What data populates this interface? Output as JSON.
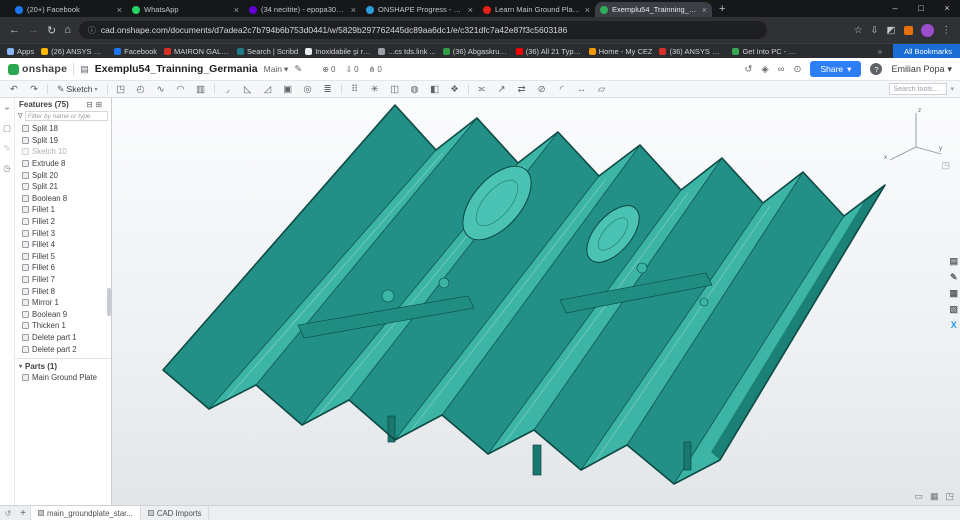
{
  "browser": {
    "tabs": [
      {
        "label": "(20+) Facebook",
        "favicon_color": "#1877f2"
      },
      {
        "label": "WhatsApp",
        "favicon_color": "#25d366"
      },
      {
        "label": "(34 necitite) - epopa3000@yah...",
        "favicon_color": "#6001d2"
      },
      {
        "label": "ONSHAPE Progress - Mind Lus...",
        "favicon_color": "#2d9cdb"
      },
      {
        "label": "Learn Main Ground Plate Onsh...",
        "favicon_color": "#e62117"
      },
      {
        "label": "Exemplu54_Trainning_Germani...",
        "favicon_color": "#2fae57"
      }
    ],
    "tab_close_glyph": "×",
    "new_tab_glyph": "+",
    "window_controls": {
      "minimize": "–",
      "maximize": "□",
      "close": "×"
    },
    "nav": {
      "back": "←",
      "forward": "→",
      "reload": "↻",
      "home": "⌂"
    },
    "address": {
      "info_icon": "ⓘ",
      "url": "cad.onshape.com/documents/d7adea2c7b794b6b753d0441/w/5829b297762445dc89aa6dc1/e/c321dfc7a42e87f3c5603186"
    },
    "address_icons": {
      "star": "☆",
      "downloads": "⇩",
      "extensions": "◩",
      "menu": "⋮"
    },
    "extension_dot_color": "#e8710a",
    "avatar_color": "#9c4dcc",
    "bookmarks": [
      {
        "label": "Apps",
        "favicon_color": "#8ab4f8"
      },
      {
        "label": "(26) ANSYS Workbe...",
        "favicon_color": "#ffb900"
      },
      {
        "label": "Facebook",
        "favicon_color": "#1877f2"
      },
      {
        "label": "MAIRON GALATI SA",
        "favicon_color": "#d93025"
      },
      {
        "label": "Search | Scribd",
        "favicon_color": "#1e7b85"
      },
      {
        "label": "Inoxidabile şi rezist...",
        "favicon_color": "#e8eaed"
      },
      {
        "label": "...cs tds.link ...",
        "favicon_color": "#9aa0a6"
      },
      {
        "label": "(36) Abgaskruemme...",
        "favicon_color": "#2e9e46"
      },
      {
        "label": "(36) All 21 Types of...",
        "favicon_color": "#ff0000"
      },
      {
        "label": "Home - My CEZ",
        "favicon_color": "#f29900"
      },
      {
        "label": "(36) ANSYS Workbe...",
        "favicon_color": "#d93025"
      },
      {
        "label": "Get Into PC - Downl...",
        "favicon_color": "#34a853"
      }
    ],
    "bookmarks_overflow_glyph": "»",
    "all_bookmarks": {
      "label": "All Bookmarks",
      "icon": "☆",
      "bg": "#1a6dd4"
    }
  },
  "onshape": {
    "brand": "onshape",
    "logo_color": "#2aa84f",
    "doc": {
      "icon": "▤",
      "title": "Exemplu54_Trainning_Germania",
      "branch": "Main",
      "caret": "▾",
      "edit_icon": "✎",
      "counters": [
        {
          "name": "likes",
          "glyph": "⊕",
          "value": "0"
        },
        {
          "name": "exports",
          "glyph": "⇩",
          "value": "0"
        },
        {
          "name": "forks",
          "glyph": "⋔",
          "value": "0"
        }
      ]
    },
    "header_icons": [
      {
        "name": "history",
        "glyph": "↺"
      },
      {
        "name": "follow",
        "glyph": "◈"
      },
      {
        "name": "share-link",
        "glyph": "∞"
      },
      {
        "name": "notifications",
        "glyph": "⊙"
      }
    ],
    "share_label": "Share",
    "share_caret": "▾",
    "help_glyph": "?",
    "user": {
      "name": "Emilian Popa",
      "caret": "▾"
    },
    "toolbar": {
      "undo_glyph": "↶",
      "redo_glyph": "↷",
      "sketch": {
        "glyph": "✎",
        "label": "Sketch",
        "caret": "▾"
      },
      "tools": [
        {
          "name": "extrude",
          "glyph": "◳"
        },
        {
          "name": "revolve",
          "glyph": "◴"
        },
        {
          "name": "sweep",
          "glyph": "∿"
        },
        {
          "name": "loft",
          "glyph": "◠"
        },
        {
          "name": "thicken",
          "glyph": "▥"
        },
        {
          "name": "fillet",
          "glyph": "◞"
        },
        {
          "name": "chamfer",
          "glyph": "◺"
        },
        {
          "name": "draft",
          "glyph": "◿"
        },
        {
          "name": "shell",
          "glyph": "▣"
        },
        {
          "name": "hole",
          "glyph": "◎"
        },
        {
          "name": "rib",
          "glyph": "≣"
        },
        {
          "name": "linear-pattern",
          "glyph": "⠿"
        },
        {
          "name": "circular-pattern",
          "glyph": "✳"
        },
        {
          "name": "mirror",
          "glyph": "◫"
        },
        {
          "name": "boolean",
          "glyph": "◍"
        },
        {
          "name": "split",
          "glyph": "◧"
        },
        {
          "name": "transform",
          "glyph": "❖"
        },
        {
          "name": "offset-surface",
          "glyph": "≍"
        },
        {
          "name": "move-face",
          "glyph": "↗"
        },
        {
          "name": "replace-face",
          "glyph": "⇄"
        },
        {
          "name": "delete-face",
          "glyph": "⊘"
        },
        {
          "name": "modify-fillet",
          "glyph": "◜"
        },
        {
          "name": "measure",
          "glyph": "↔"
        },
        {
          "name": "sheet-metal",
          "glyph": "▱"
        }
      ],
      "search_placeholder": "Search tools...",
      "search_caret": "▾"
    },
    "left_rail": [
      {
        "name": "select",
        "glyph": "⌖"
      },
      {
        "name": "comments",
        "glyph": "▢"
      },
      {
        "name": "annotations",
        "glyph": "✎"
      },
      {
        "name": "history",
        "glyph": "◷"
      }
    ],
    "features": {
      "title": "Features (75)",
      "header_icons": [
        {
          "name": "collapse-all",
          "glyph": "⊟"
        },
        {
          "name": "filter-options",
          "glyph": "⊞"
        }
      ],
      "filter_icon": "∇",
      "filter_placeholder": "Filter by name or type",
      "items": [
        {
          "label": "Split 18"
        },
        {
          "label": "Split 19"
        },
        {
          "label": "Sketch 10"
        },
        {
          "label": "Extrude 8"
        },
        {
          "label": "Split 20"
        },
        {
          "label": "Split 21"
        },
        {
          "label": "Boolean 8"
        },
        {
          "label": "Fillet 1"
        },
        {
          "label": "Fillet 2"
        },
        {
          "label": "Fillet 3"
        },
        {
          "label": "Fillet 4"
        },
        {
          "label": "Fillet 5"
        },
        {
          "label": "Fillet 6"
        },
        {
          "label": "Fillet 7"
        },
        {
          "label": "Fillet 8"
        },
        {
          "label": "Mirror 1"
        },
        {
          "label": "Boolean 9"
        },
        {
          "label": "Thicken 1"
        },
        {
          "label": "Delete part 1"
        },
        {
          "label": "Delete part 2"
        }
      ],
      "parts_title": "Parts (1)",
      "parts_caret": "▾",
      "parts": [
        {
          "label": "Main Ground Plate"
        }
      ]
    },
    "viewport": {
      "part_color": "#2ba79a",
      "part_name": "Main Ground Plate",
      "triad": {
        "x": "x",
        "y": "y",
        "z": "z"
      },
      "view_cube_menu_glyph": "◳",
      "right_dock": [
        {
          "name": "appearance-panel",
          "glyph": "▤",
          "color": "#5f6368"
        },
        {
          "name": "markup-panel",
          "glyph": "✎",
          "color": "#5f6368"
        },
        {
          "name": "grid-panel",
          "glyph": "▦",
          "color": "#5f6368"
        },
        {
          "name": "print-panel",
          "glyph": "▧",
          "color": "#5f6368"
        },
        {
          "name": "x-app",
          "glyph": "X",
          "color": "#1d9bf0"
        }
      ],
      "corner_icons": [
        {
          "name": "view-grid",
          "glyph": "▭"
        },
        {
          "name": "view-shaded",
          "glyph": "▦"
        },
        {
          "name": "view-expand",
          "glyph": "◳"
        }
      ]
    },
    "bottom_bar": {
      "status_glyph": "↺",
      "add_tab_glyph": "+",
      "tabs": [
        {
          "label": "main_groundplate_star..."
        },
        {
          "label": "CAD Imports"
        }
      ]
    }
  }
}
